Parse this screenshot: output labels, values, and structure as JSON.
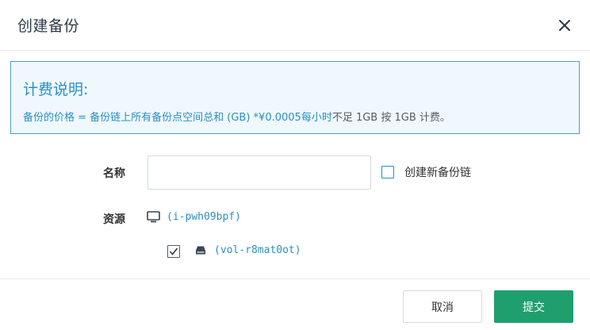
{
  "dialog": {
    "title": "创建备份",
    "close_icon": "close-icon"
  },
  "notice": {
    "title": "计费说明:",
    "formula": "备份的价格 = 备份链上所有备份点空间总和 (GB) *¥0.0005每小时",
    "note": "不足 1GB 按 1GB 计费。"
  },
  "form": {
    "name_label": "名称",
    "name_value": "",
    "new_chain_label": "创建新备份链",
    "new_chain_checked": false,
    "resource_label": "资源",
    "instance": {
      "icon": "monitor-icon",
      "id": "(i-pwh09bpf)"
    },
    "volume": {
      "icon": "disk-icon",
      "id": "(vol-r8mat0ot)",
      "checked": true
    }
  },
  "footer": {
    "cancel_label": "取消",
    "submit_label": "提交"
  },
  "colors": {
    "accent": "#2a8fc6",
    "notice_bg": "#eff8fc",
    "submit": "#1f9e6e"
  }
}
